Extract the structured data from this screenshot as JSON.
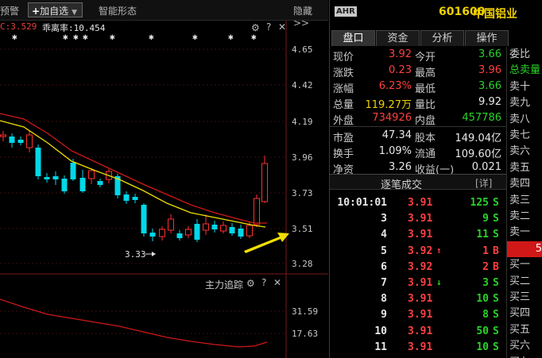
{
  "toolbar": {
    "warn": "预警",
    "add_plus": "+",
    "add": "加自选",
    "pattern": "智能形态",
    "hide": "隐藏>>"
  },
  "indicator": {
    "c_text": "C:3.529",
    "bias_text": "乖离率:10.454"
  },
  "main_chart": {
    "price_labels": [
      "4.65",
      "4.42",
      "4.19",
      "3.96",
      "3.73",
      "3.51",
      "3.28"
    ],
    "low_marker": "3.33",
    "colors": {
      "up": "#ff3030",
      "down": "#00d8e8",
      "ma_short": "#f0e000",
      "ma_long": "#d01818",
      "grid": "#3a1010",
      "arrow": "#f0e000"
    }
  },
  "sub_chart": {
    "title": "主力追踪",
    "labels": [
      "31.59",
      "17.63"
    ]
  },
  "quote": {
    "badge": "AHR",
    "code": "601600",
    "name": "中国铝业",
    "tabs": [
      "盘口",
      "资金",
      "分析",
      "操作"
    ],
    "stats": [
      {
        "l1": "现价",
        "v1": "3.92",
        "c1": "red",
        "l2": "今开",
        "v2": "3.66",
        "c2": "green"
      },
      {
        "l1": "涨跌",
        "v1": "0.23",
        "c1": "red",
        "l2": "最高",
        "v2": "3.96",
        "c2": "red"
      },
      {
        "l1": "涨幅",
        "v1": "6.23%",
        "c1": "red",
        "l2": "最低",
        "v2": "3.66",
        "c2": "green"
      },
      {
        "l1": "总量",
        "v1": "119.27万",
        "c1": "yellow",
        "l2": "量比",
        "v2": "9.92",
        "c2": "white"
      },
      {
        "l1": "外盘",
        "v1": "734926",
        "c1": "red",
        "l2": "内盘",
        "v2": "457786",
        "c2": "green"
      },
      {
        "l1": "市盈",
        "v1": "47.34",
        "c1": "white",
        "l2": "股本",
        "v2": "149.04亿",
        "c2": "white"
      },
      {
        "l1": "换手",
        "v1": "1.09%",
        "c1": "white",
        "l2": "流通",
        "v2": "109.60亿",
        "c2": "white"
      },
      {
        "l1": "净资",
        "v1": "3.26",
        "c1": "white",
        "l2": "收益(一)",
        "v2": "0.021",
        "c2": "white"
      }
    ],
    "trades_title": "逐笔成交",
    "trades_detail": "[详]",
    "trades": [
      {
        "time": "10:01:01",
        "price": "3.91",
        "arrow": "",
        "vol": "125",
        "side": "S"
      },
      {
        "time": "3",
        "price": "3.91",
        "arrow": "",
        "vol": "9",
        "side": "S"
      },
      {
        "time": "4",
        "price": "3.91",
        "arrow": "",
        "vol": "11",
        "side": "S"
      },
      {
        "time": "5",
        "price": "3.92",
        "arrow": "↑",
        "vol": "1",
        "side": "B"
      },
      {
        "time": "6",
        "price": "3.92",
        "arrow": "",
        "vol": "2",
        "side": "B"
      },
      {
        "time": "7",
        "price": "3.91",
        "arrow": "↓",
        "vol": "3",
        "side": "S"
      },
      {
        "time": "8",
        "price": "3.91",
        "arrow": "",
        "vol": "10",
        "side": "S"
      },
      {
        "time": "9",
        "price": "3.91",
        "arrow": "",
        "vol": "8",
        "side": "S"
      },
      {
        "time": "10",
        "price": "3.91",
        "arrow": "",
        "vol": "50",
        "side": "S"
      },
      {
        "time": "11",
        "price": "3.91",
        "arrow": "",
        "vol": "10",
        "side": "S"
      }
    ],
    "orderbook": [
      "委比",
      "总卖量",
      "卖十",
      "卖九",
      "卖八",
      "卖七",
      "卖六",
      "卖五",
      "卖四",
      "卖三",
      "卖二",
      "卖一",
      "",
      "买一",
      "买二",
      "买三",
      "买四",
      "买五",
      "买六",
      "买七"
    ],
    "current_price_partial": "5"
  }
}
